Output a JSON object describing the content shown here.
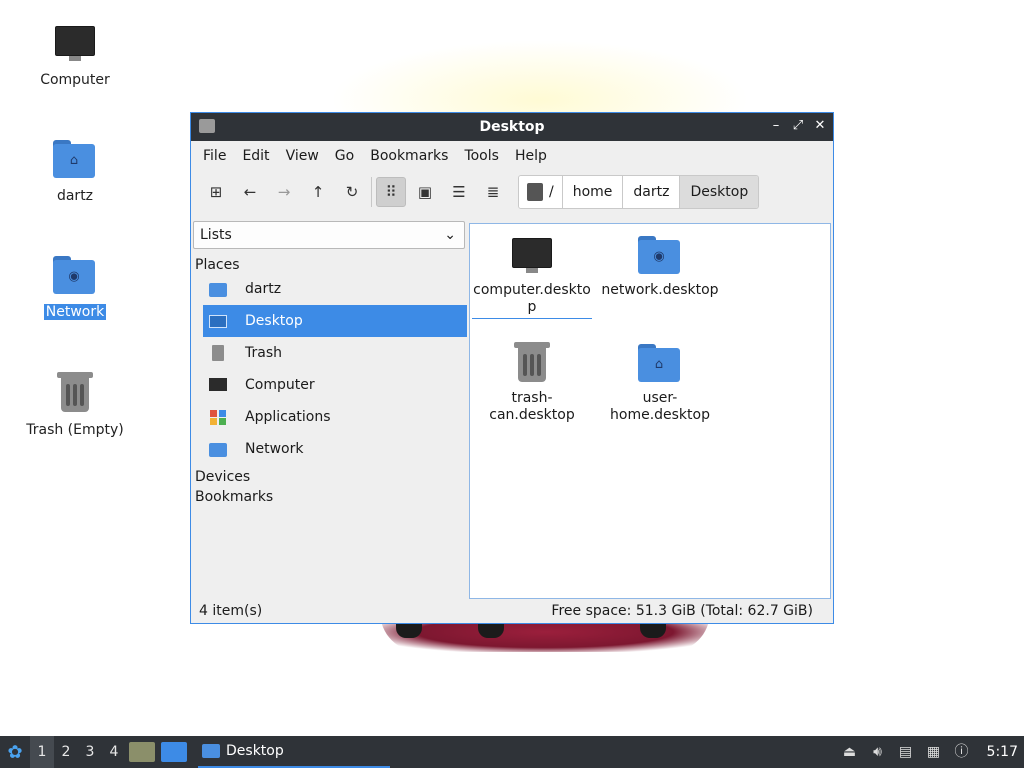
{
  "desktop": {
    "icons": [
      {
        "label": "Computer",
        "icon": "monitor-icon"
      },
      {
        "label": "dartz",
        "icon": "home-folder-icon"
      },
      {
        "label": "Network",
        "icon": "network-folder-icon"
      },
      {
        "label": "Trash (Empty)",
        "icon": "trash-icon"
      }
    ]
  },
  "window": {
    "title": "Desktop",
    "controls": {
      "minimize": "–",
      "maximize": "⤢",
      "close": "✕"
    },
    "menu": [
      "File",
      "Edit",
      "View",
      "Go",
      "Bookmarks",
      "Tools",
      "Help"
    ],
    "path": {
      "root": "/",
      "segments": [
        "home",
        "dartz"
      ],
      "current": "Desktop"
    },
    "sidebar": {
      "select_value": "Lists",
      "places_heading": "Places",
      "places": [
        {
          "label": "dartz",
          "icon": "home-folder-icon"
        },
        {
          "label": "Desktop",
          "icon": "desktop-icon"
        },
        {
          "label": "Trash",
          "icon": "trash-icon"
        },
        {
          "label": "Computer",
          "icon": "monitor-icon"
        },
        {
          "label": "Applications",
          "icon": "applications-icon"
        },
        {
          "label": "Network",
          "icon": "network-folder-icon"
        }
      ],
      "devices_heading": "Devices",
      "bookmarks_heading": "Bookmarks"
    },
    "files": [
      {
        "name_line1": "computer.deskto",
        "name_line2": "p",
        "icon": "monitor-icon"
      },
      {
        "name_line1": "network.desktop",
        "name_line2": "",
        "icon": "network-folder-icon"
      },
      {
        "name_line1": "trash-",
        "name_line2": "can.desktop",
        "icon": "trash-icon"
      },
      {
        "name_line1": "user-",
        "name_line2": "home.desktop",
        "icon": "home-folder-icon"
      }
    ],
    "status": {
      "items": "4 item(s)",
      "free_space": "Free space: 51.3 GiB (Total: 62.7 GiB)"
    }
  },
  "taskbar": {
    "workspaces": [
      "1",
      "2",
      "3",
      "4"
    ],
    "task": "Desktop",
    "clock": "5:17"
  },
  "colors": {
    "accent": "#3d8be6",
    "titlebar": "#2f3338",
    "folder": "#4a8fe0"
  }
}
